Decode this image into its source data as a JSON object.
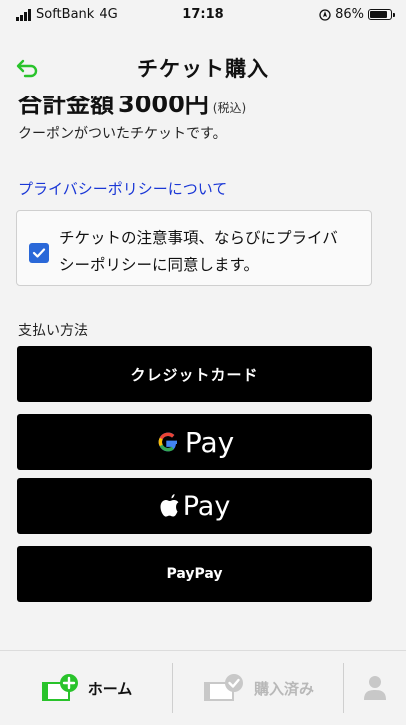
{
  "status_bar": {
    "carrier": "SoftBank",
    "network": "4G",
    "time": "17:18",
    "battery_percent": "86%",
    "battery_level": 0.86
  },
  "header": {
    "title": "チケット購入"
  },
  "summary": {
    "total_label": "合計金額",
    "total_value": "3000円",
    "total_note": "(税込)",
    "coupon_text": "クーポンがついたチケットです。"
  },
  "privacy": {
    "link_text": "プライバシーポリシーについて"
  },
  "consent": {
    "text_line1": "チケットの注意事項、ならびにプライバ",
    "text_line2": "シーポリシーに同意します。",
    "checked": true
  },
  "payment": {
    "section_label": "支払い方法",
    "credit_card_label": "クレジットカード",
    "google_pay_label": "Pay",
    "apple_pay_label": "Pay",
    "paypay_label": "PayPay"
  },
  "tabs": [
    {
      "label": "ホーム",
      "icon": "home-ticket-plus-icon",
      "active": true
    },
    {
      "label": "購入済み",
      "icon": "ticket-check-icon",
      "active": false
    },
    {
      "label": "",
      "icon": "person-icon",
      "active": false
    }
  ],
  "colors": {
    "accent_green": "#29c32b",
    "link_blue": "#1a37d6",
    "checkbox_blue": "#2a68d8",
    "button_black": "#000000"
  }
}
